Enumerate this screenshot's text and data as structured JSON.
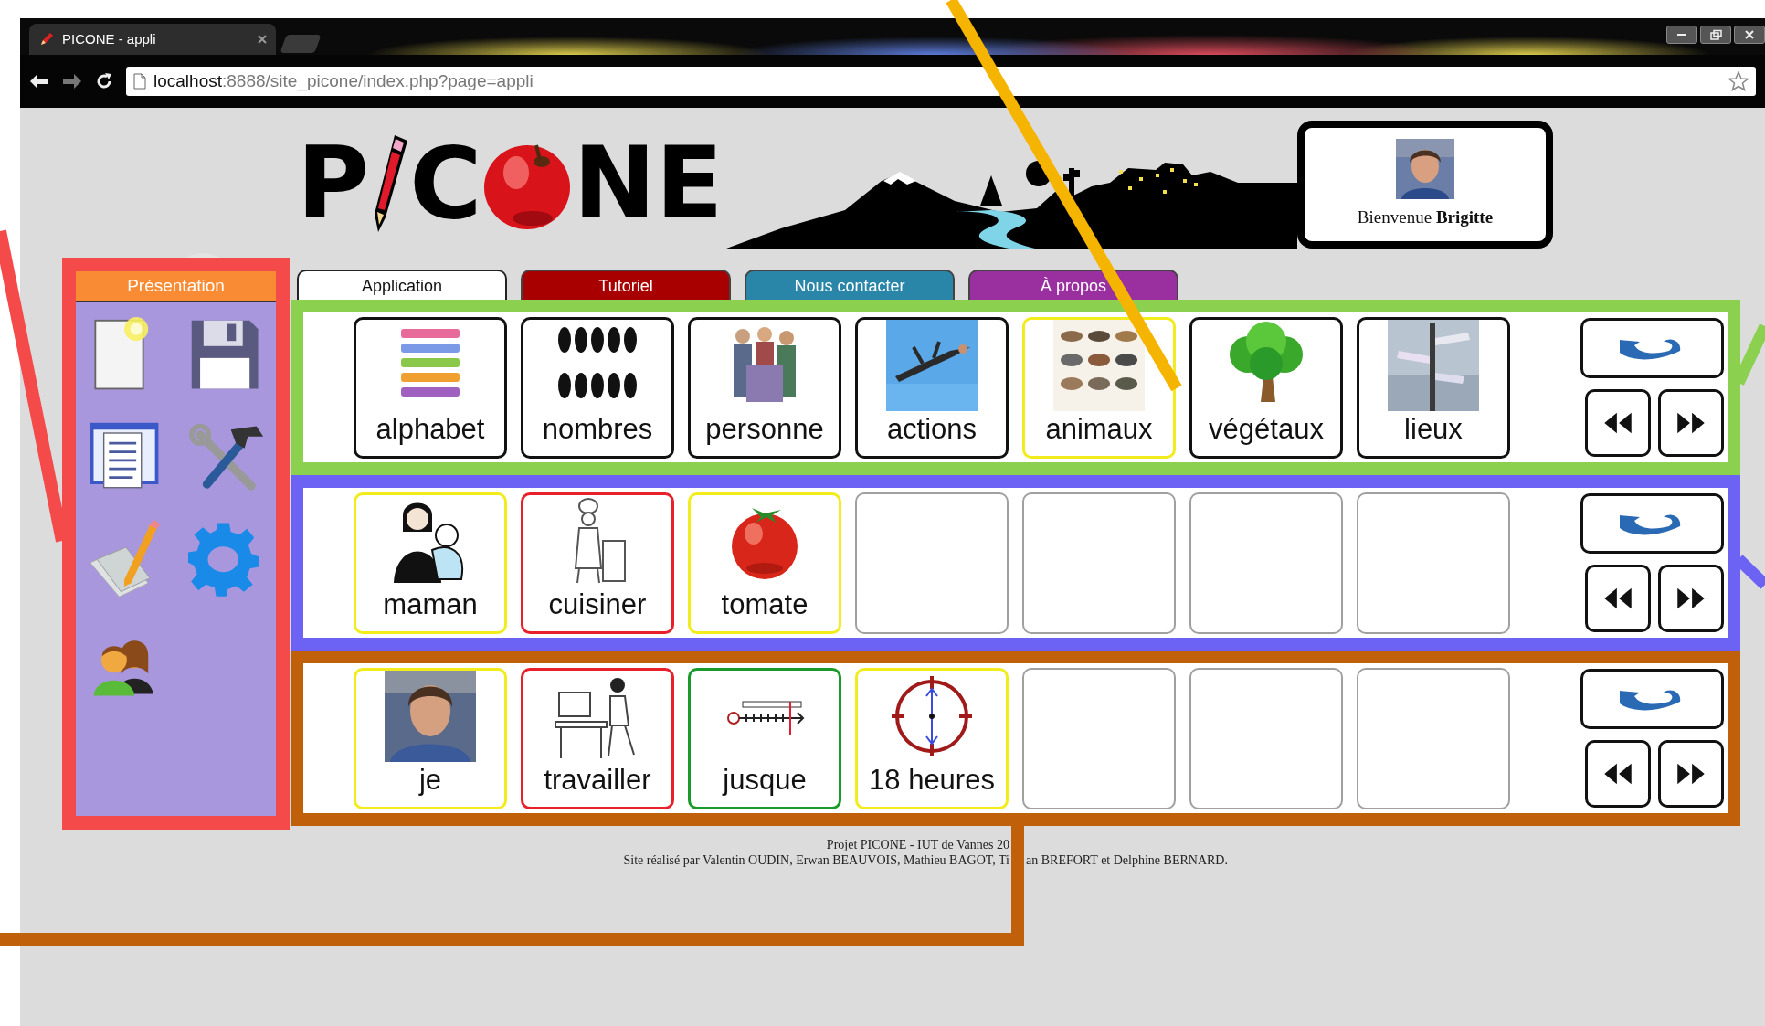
{
  "browser": {
    "tab_title": "PICONE - appli",
    "url_host": "localhost",
    "url_path": ":8888/site_picone/index.php?page=appli"
  },
  "logo": {
    "parts": [
      "P",
      "C",
      "NE"
    ]
  },
  "welcome": "Bienvenue **Brigitte**",
  "tabs": [
    {
      "label": "Application",
      "color": "#ffffff",
      "selected": true
    },
    {
      "label": "Tutoriel",
      "color": "#a80000",
      "selected": false
    },
    {
      "label": "Nous contacter",
      "color": "#2a86a8",
      "selected": false
    },
    {
      "label": "À propos",
      "color": "#9a2fa0",
      "selected": false
    }
  ],
  "sidebar": {
    "title": "Présentation",
    "tools": [
      {
        "kind": "new"
      },
      {
        "kind": "save"
      },
      {
        "kind": "window"
      },
      {
        "kind": "tools"
      },
      {
        "kind": "edit"
      },
      {
        "kind": "settings"
      },
      {
        "kind": "users"
      }
    ]
  },
  "rows": [
    {
      "color": "#8bd14f",
      "cards": [
        {
          "kind": "picture",
          "label": "alphabet",
          "color": "#111111"
        },
        {
          "kind": "picture",
          "label": "nombres",
          "color": "#111111"
        },
        {
          "kind": "picture",
          "label": "personne",
          "color": "#111111"
        },
        {
          "kind": "picture",
          "label": "actions",
          "color": "#111111"
        },
        {
          "kind": "picture",
          "label": "animaux",
          "color": "#f2ec1c"
        },
        {
          "kind": "picture",
          "label": "végétaux",
          "color": "#111111"
        },
        {
          "kind": "picture",
          "label": "lieux",
          "color": "#111111"
        }
      ]
    },
    {
      "color": "#6c63f5",
      "cards": [
        {
          "kind": "picture",
          "label": "maman",
          "color": "#f2ec1c"
        },
        {
          "kind": "picture",
          "label": "cuisiner",
          "color": "#e8202a"
        },
        {
          "kind": "picture",
          "label": "tomate",
          "color": "#f2ec1c"
        },
        {
          "kind": "empty",
          "color": "#a0a0a0"
        },
        {
          "kind": "empty",
          "color": "#a0a0a0"
        },
        {
          "kind": "empty",
          "color": "#a0a0a0"
        },
        {
          "kind": "empty",
          "color": "#a0a0a0"
        }
      ]
    },
    {
      "color": "#c0600a",
      "cards": [
        {
          "kind": "picture",
          "label": "je",
          "color": "#f2ec1c"
        },
        {
          "kind": "picture",
          "label": "travailler",
          "color": "#e8202a"
        },
        {
          "kind": "picture",
          "label": "jusque",
          "color": "#1a9a2a"
        },
        {
          "kind": "picture",
          "label": "18 heures",
          "color": "#f2ec1c"
        },
        {
          "kind": "empty",
          "color": "#a0a0a0"
        },
        {
          "kind": "empty",
          "color": "#a0a0a0"
        },
        {
          "kind": "empty",
          "color": "#a0a0a0"
        }
      ]
    }
  ],
  "footer": {
    "line_1": "Projet PICONE - IUT de Vannes 20",
    "line_2_before": "Site réalisé par Valentin OUDIN, Erwan BEAUVOIS, Mathieu BAGOT, Ti",
    "line_2_after": "an BREFORT et Delphine BERNARD."
  }
}
